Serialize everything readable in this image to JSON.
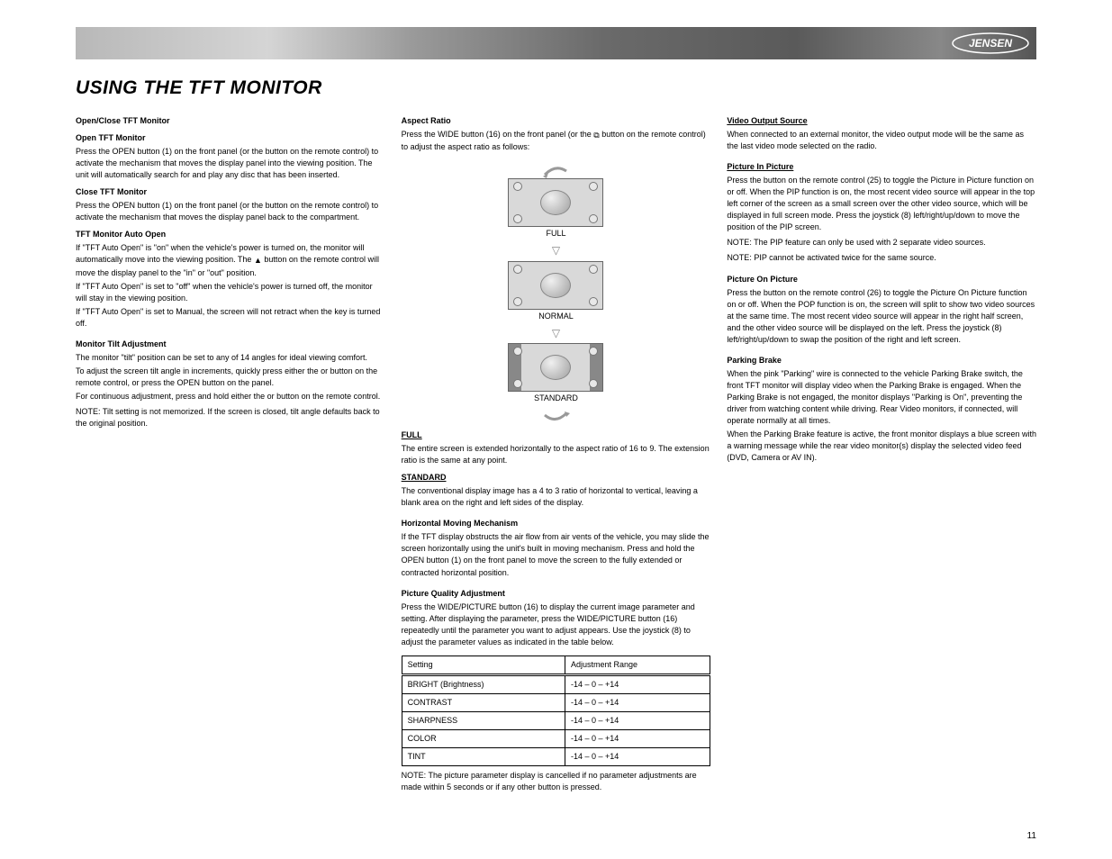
{
  "logo_text": "JENSEN",
  "page_title": "USING THE TFT MONITOR",
  "page_number": "11",
  "col1": {
    "h1": "Open/Close TFT Monitor",
    "open_h": "Open TFT Monitor",
    "open_p": "Press the OPEN button (1) on the front panel (or the          button on the remote control) to activate the mechanism that moves the display panel into the viewing position. The unit will automatically search for and play any disc that has been inserted.",
    "close_h": "Close TFT Monitor",
    "close_p": "Press the OPEN button (1) on the front panel (or the          button on the remote control) to activate the mechanism that moves the display panel back to the compartment.",
    "autoopen_h": "TFT Monitor Auto Open",
    "autoopen_p1": "If \"TFT Auto Open\" is \"on\" when the vehicle's power is turned on, the monitor will automatically move into the viewing position. The",
    "autoopen_p_cont": "         button on the remote control will move the display panel to the \"in\" or \"out\" position.",
    "autoopen_p2": "If \"TFT Auto Open\" is set to \"off\" when the vehicle's power is turned off, the monitor will stay in the viewing position.",
    "autoopen_p3": "If \"TFT Auto Open\" is set to Manual, the screen will not retract when the key is turned off.",
    "tilt_h": "Monitor Tilt Adjustment",
    "tilt_p1": "The monitor \"tilt\" position can be set to any of 14 angles for ideal viewing comfort.",
    "tilt_p2": "To adjust the screen tilt angle in increments, quickly press either the         or         button on the remote control, or press the OPEN button on the panel.",
    "tilt_p3": "For continuous adjustment, press and hold either the         or         button on the remote control.",
    "note_label": "NOTE: ",
    "tilt_note": "Tilt setting is not memorized. If the screen is closed, tilt angle defaults back to the original position."
  },
  "col2": {
    "aspect_h": "Aspect Ratio",
    "aspect_p": "Press the WIDE button (16) on the front panel (or the",
    "aspect_p_cont": "         button on the remote control) to adjust the aspect ratio as follows:",
    "label_full": "FULL",
    "full_desc": "The entire screen is extended horizontally to the aspect ratio of 16 to 9. The extension ratio is the same at any point.",
    "label_normal": "NORMAL",
    "label_standard": "STANDARD",
    "standard_desc": "The conventional display image has a 4 to 3 ratio of horizontal to vertical, leaving a blank area on the right and left sides of the display.",
    "hmove_h": "Horizontal Moving Mechanism",
    "hmove_p": "If the TFT display obstructs the air flow from air vents of the vehicle, you may slide the screen horizontally using the unit's built in moving mechanism. Press and hold the OPEN button (1) on the front panel to move the screen to the fully extended or contracted horizontal position.",
    "pq_h": "Picture Quality Adjustment",
    "pq_p": "Press the WIDE/PICTURE button (16) to display the current image parameter and setting. After displaying the parameter, press the WIDE/PICTURE button (16) repeatedly until the parameter you want to adjust appears. Use the joystick (8) to adjust the parameter values as indicated in the table below.",
    "table": {
      "h1": "Setting",
      "h2": "Adjustment Range",
      "rows": [
        [
          "BRIGHT (Brightness)",
          "-14 – 0 – +14"
        ],
        [
          "CONTRAST",
          "-14 – 0 – +14"
        ],
        [
          "SHARPNESS",
          "-14 – 0 – +14"
        ],
        [
          "COLOR",
          "-14 – 0 – +14"
        ],
        [
          "TINT",
          "-14 – 0 – +14"
        ]
      ]
    },
    "pq_note": "The picture parameter display is cancelled if no parameter adjustments are made within 5 seconds or if any other button is pressed."
  },
  "col3": {
    "vout_h": "Video Output Source",
    "vout_p": "When connected to an external monitor, the video output mode will be the same as the last video mode selected on the radio.",
    "pip_h": "Picture In Picture",
    "pip_p": "Press the         button on the remote control (25) to toggle the Picture in Picture function on or off. When the PIP function is on, the most recent video source will appear in the top left corner of the screen as a small screen over the other video source, which will be displayed in full screen mode. Press the joystick (8) left/right/up/down to move the position of the PIP screen.",
    "pip_note1_label": "NOTE: ",
    "pip_note1": "The PIP feature can only be used with 2 separate video sources.",
    "pip_note2_label": "NOTE: ",
    "pip_note2": "PIP cannot be activated twice for the same source.",
    "pop_h": "Picture On Picture",
    "pop_p": "Press the         button on the remote control (26) to toggle the Picture On Picture function on or off. When the POP function is on, the screen will split to show two video sources at the same time. The most recent video source will appear in the right half screen, and the other video source will be displayed on the left. Press the joystick (8) left/right/up/down to swap the position of the right and left screen.",
    "brake_h": "Parking Brake",
    "brake_p1": "When the pink \"Parking\" wire is connected to the vehicle Parking Brake switch, the front TFT monitor will display video when the Parking Brake is engaged. When the Parking Brake is not engaged, the monitor displays \"Parking is On\", preventing the driver from watching content while driving. Rear Video monitors, if connected, will operate normally at all times.",
    "brake_p2": "When the Parking Brake feature is active, the front monitor displays a blue screen with a warning message while the rear video monitor(s) display the selected video feed (DVD, Camera or AV IN)."
  }
}
